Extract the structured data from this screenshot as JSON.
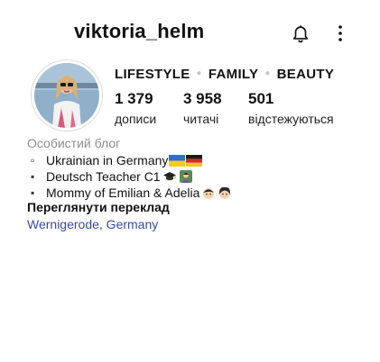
{
  "header": {
    "username": "viktoria_helm",
    "icons": {
      "notifications": "bell-icon",
      "more": "more-vertical-icon"
    }
  },
  "profile": {
    "avatar": "avatar-photo",
    "categories": [
      "LIFESTYLE",
      "FAMILY",
      "BEAUTY"
    ],
    "stats": [
      {
        "value": "1 379",
        "label": "дописи"
      },
      {
        "value": "3 958",
        "label": "читачі"
      },
      {
        "value": "501",
        "label": "відстежуються"
      }
    ]
  },
  "bio": {
    "category": "Особистий блог",
    "lines": [
      {
        "text": "Ukrainian in Germany",
        "emojis": [
          "ukraine-flag",
          "germany-flag"
        ]
      },
      {
        "text": "Deutsch Teacher C1",
        "emojis": [
          "graduation-cap",
          "teacher"
        ]
      },
      {
        "text": "Mommy of Emilian & Adelia ",
        "emojis": [
          "boy",
          "girl"
        ]
      }
    ],
    "translate_link": "Переглянути переклад",
    "location": "Wernigerode, Germany"
  },
  "colors": {
    "link": "#3a4a9e",
    "secondary_text": "#8e8e8e"
  }
}
